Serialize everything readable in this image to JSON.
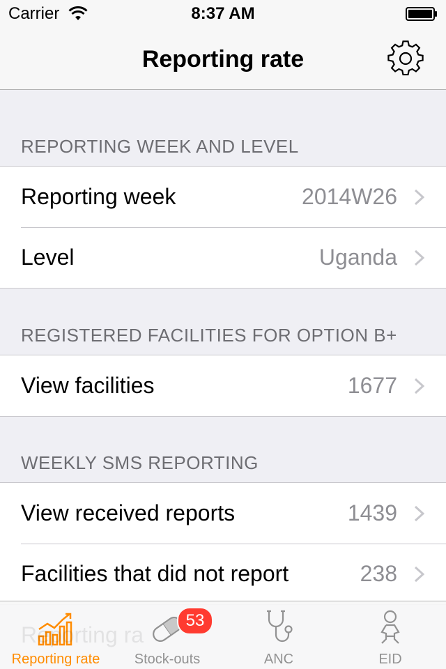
{
  "status_bar": {
    "carrier": "Carrier",
    "time": "8:37 AM"
  },
  "nav": {
    "title": "Reporting rate",
    "settings_icon": "gear-icon"
  },
  "sections": [
    {
      "header": "REPORTING WEEK AND LEVEL",
      "rows": [
        {
          "label": "Reporting week",
          "value": "2014W26"
        },
        {
          "label": "Level",
          "value": "Uganda"
        }
      ]
    },
    {
      "header": "REGISTERED FACILITIES FOR OPTION B+",
      "rows": [
        {
          "label": "View facilities",
          "value": "1677"
        }
      ]
    },
    {
      "header": "WEEKLY SMS REPORTING",
      "rows": [
        {
          "label": "View received reports",
          "value": "1439"
        },
        {
          "label": "Facilities that did not report",
          "value": "238"
        }
      ]
    }
  ],
  "partially_hidden_row": "Reporting ra",
  "tabs": [
    {
      "label": "Reporting rate",
      "icon": "bar-chart-icon",
      "active": true
    },
    {
      "label": "Stock-outs",
      "icon": "pill-icon",
      "badge": "53"
    },
    {
      "label": "ANC",
      "icon": "stethoscope-icon"
    },
    {
      "label": "EID",
      "icon": "baby-icon"
    }
  ],
  "colors": {
    "accent": "#ff8c00",
    "badge": "#ff3b30",
    "secondary_text": "#8e8e93",
    "header_text": "#6d6d72",
    "background": "#efeff4"
  }
}
